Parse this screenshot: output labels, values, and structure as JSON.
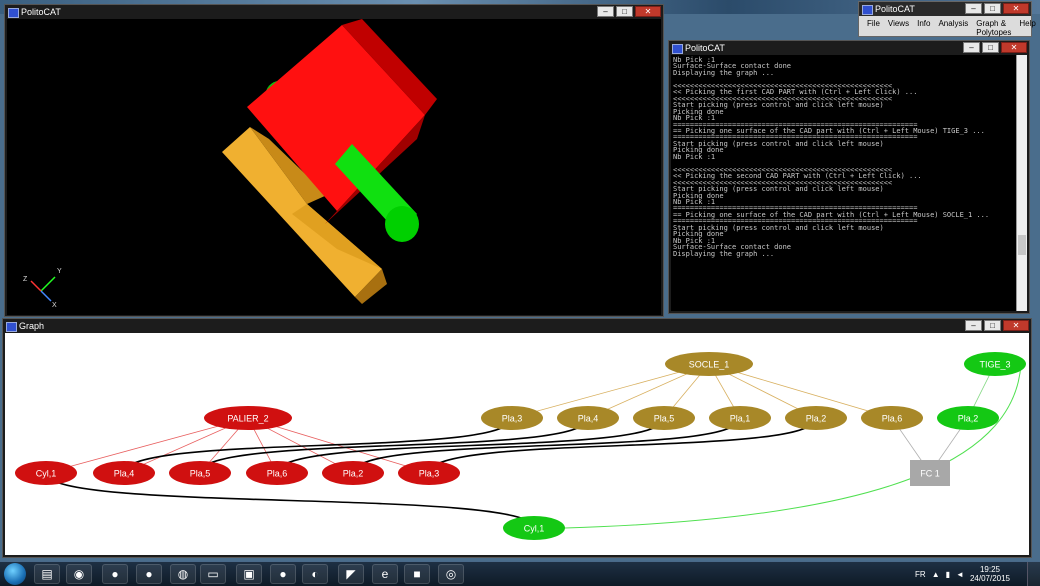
{
  "viewer": {
    "title": "PolitoCAT",
    "axes": {
      "x": "X",
      "y": "Y",
      "z": "Z"
    }
  },
  "console": {
    "title": "PolitoCAT",
    "lines": [
      "Nb Pick :1",
      "Surface-Surface contact done",
      "Displaying the graph ...",
      "",
      "<<<<<<<<<<<<<<<<<<<<<<<<<<<<<<<<<<<<<<<<<<<<<<<<<<<<",
      "<< Picking the first CAD PART with (Ctrl + Left Click) ...",
      "<<<<<<<<<<<<<<<<<<<<<<<<<<<<<<<<<<<<<<<<<<<<<<<<<<<<",
      "Start picking (press control and click left mouse)",
      "Picking done",
      "Nb Pick :1",
      "==========================================================",
      "== Picking one surface of the CAD part with (Ctrl + Left Mouse) TIGE_3 ...",
      "==========================================================",
      "Start picking (press control and click left mouse)",
      "Picking done",
      "Nb Pick :1",
      "",
      "<<<<<<<<<<<<<<<<<<<<<<<<<<<<<<<<<<<<<<<<<<<<<<<<<<<<",
      "<< Picking the second CAD PART with (Ctrl + Left Click) ...",
      "<<<<<<<<<<<<<<<<<<<<<<<<<<<<<<<<<<<<<<<<<<<<<<<<<<<<",
      "Start picking (press control and click left mouse)",
      "Picking done",
      "Nb Pick :1",
      "==========================================================",
      "== Picking one surface of the CAD part with (Ctrl + Left Mouse) SOCLE_1 ...",
      "==========================================================",
      "Start picking (press control and click left mouse)",
      "Picking done",
      "Nb Pick :1",
      "Surface-Surface contact done",
      "Displaying the graph ..."
    ]
  },
  "menuwin": {
    "title": "PolitoCAT",
    "menus": [
      "File",
      "Views",
      "Info",
      "Analysis",
      "Graph & Polytopes",
      "Help"
    ]
  },
  "graph": {
    "title": "Graph",
    "colors": {
      "red": "#d01010",
      "gold": "#a88828",
      "green": "#14c814",
      "gray": "#a8a8a8"
    },
    "nodes": {
      "socle": "SOCLE_1",
      "tige": "TIGE_3",
      "palier": "PALIER_2",
      "s_pla3": "Pla,3",
      "s_pla4": "Pla,4",
      "s_pla5": "Pla,5",
      "s_pla1": "Pla,1",
      "s_pla2": "Pla,2",
      "s_pla6": "Pla,6",
      "t_pla2": "Pla,2",
      "p_cyl1": "Cyl,1",
      "p_pla4": "Pla,4",
      "p_pla5": "Pla,5",
      "p_pla6": "Pla,6",
      "p_pla2": "Pla,2",
      "p_pla3": "Pla,3",
      "fc1": "FC 1",
      "t_cyl1": "Cyl,1"
    }
  },
  "taskbar": {
    "lang": "FR",
    "time": "19:25",
    "date": "24/07/2015"
  }
}
